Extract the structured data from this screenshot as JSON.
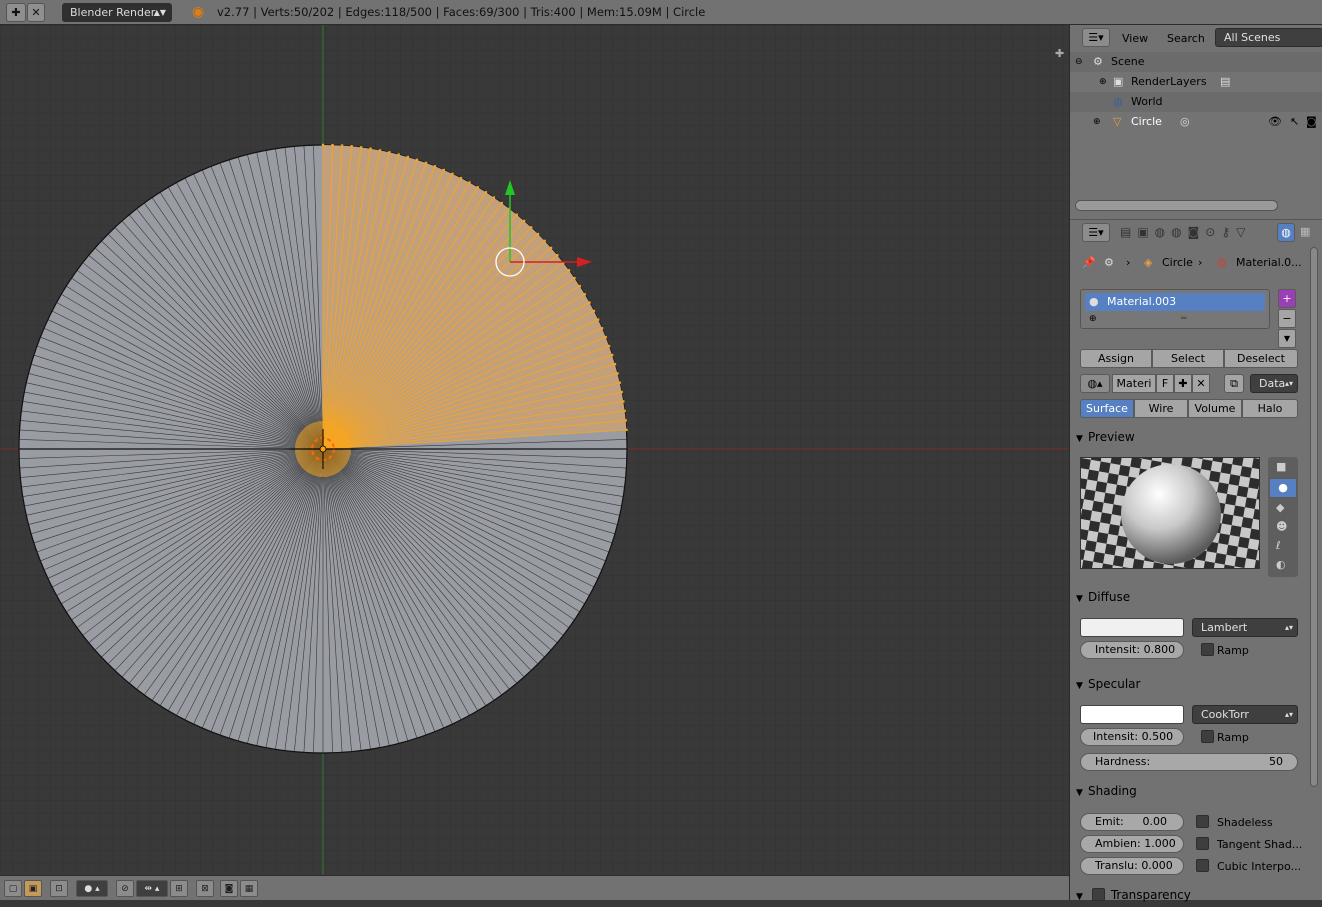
{
  "topbar": {
    "engine": "Blender Render",
    "stats": "v2.77 | Verts:50/202 | Edges:118/500 | Faces:69/300 | Tris:400 | Mem:15.09M | Circle"
  },
  "outliner": {
    "view": "View",
    "search": "Search",
    "scope": "All Scenes",
    "items": [
      {
        "label": "Scene"
      },
      {
        "label": "RenderLayers"
      },
      {
        "label": "World"
      },
      {
        "label": "Circle"
      }
    ]
  },
  "properties": {
    "breadcrumb": {
      "object": "Circle",
      "material": "Material.0..."
    },
    "material_slot": "Material.003",
    "slot_buttons": {
      "assign": "Assign",
      "select": "Select",
      "deselect": "Deselect"
    },
    "datablock": {
      "name": "Materi",
      "fake": "F",
      "link": "Data"
    },
    "tabs": [
      "Surface",
      "Wire",
      "Volume",
      "Halo"
    ],
    "preview": {
      "title": "Preview"
    },
    "diffuse": {
      "title": "Diffuse",
      "shader": "Lambert",
      "intensity_label": "Intensit:",
      "intensity": "0.800",
      "ramp": "Ramp",
      "color": "#f0f0f0"
    },
    "specular": {
      "title": "Specular",
      "shader": "CookTorr",
      "intensity_label": "Intensit:",
      "intensity": "0.500",
      "ramp": "Ramp",
      "hardness_label": "Hardness:",
      "hardness": "50",
      "color": "#ffffff"
    },
    "shading": {
      "title": "Shading",
      "emit_label": "Emit:",
      "emit": "0.00",
      "ambient_label": "Ambien:",
      "ambient": "1.000",
      "translucency_label": "Translu:",
      "translucency": "0.000",
      "shadeless": "Shadeless",
      "tangent": "Tangent Shad...",
      "cubic": "Cubic Interpo..."
    },
    "transparency": {
      "title": "Transparency"
    }
  },
  "colors": {
    "selection": "#f5a623",
    "accent": "#5680c2"
  }
}
